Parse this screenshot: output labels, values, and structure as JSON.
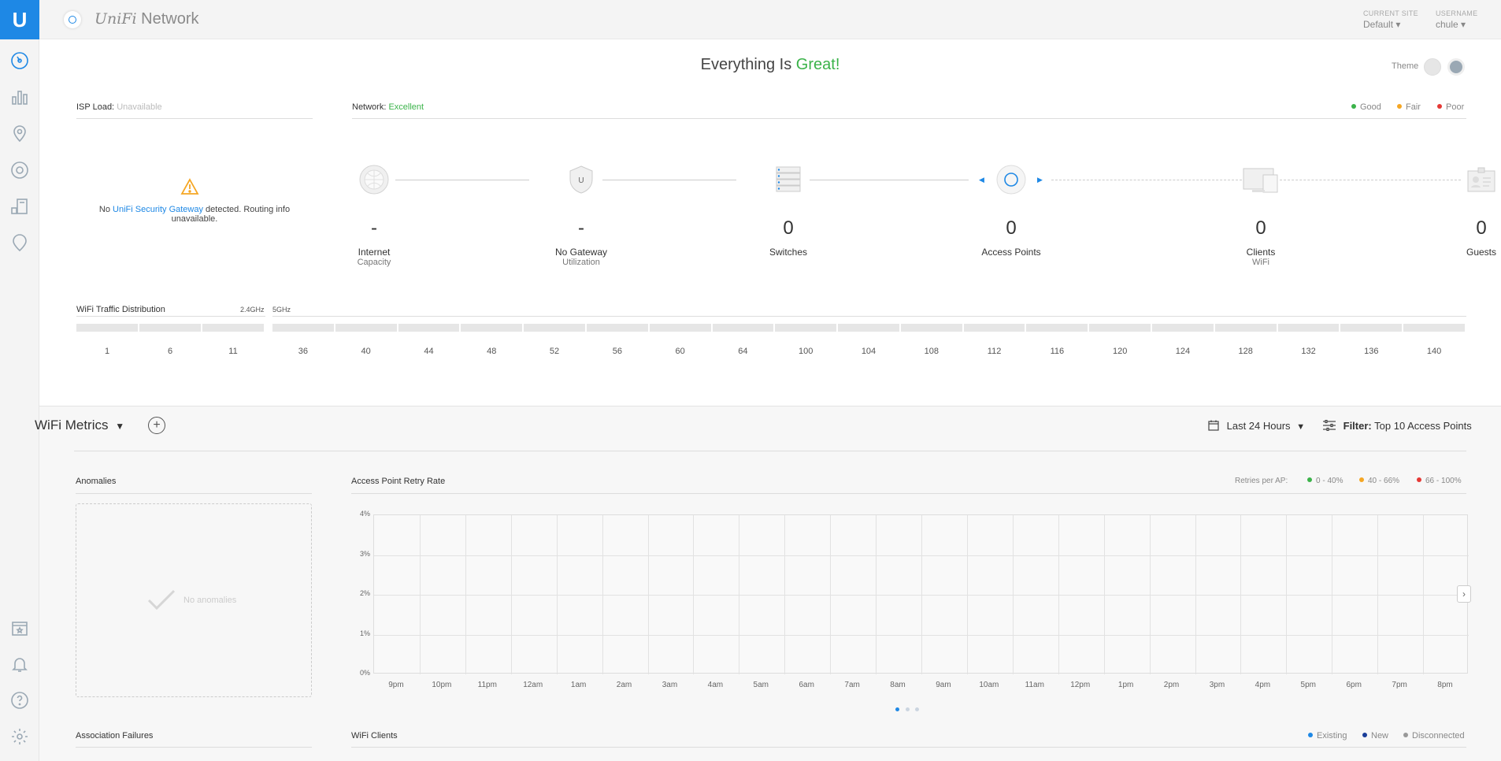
{
  "app": {
    "logo_letter": "U",
    "brand_italic": "UniFi",
    "brand_rest": " Network"
  },
  "header": {
    "site_label": "CURRENT SITE",
    "site_value": "Default ▾",
    "user_label": "USERNAME",
    "user_value": "chule ▾"
  },
  "status": {
    "prefix": "Everything Is ",
    "highlight": "Great!"
  },
  "theme_label": "Theme",
  "isp": {
    "label": "ISP Load:",
    "value": "Unavailable"
  },
  "network": {
    "label": "Network:",
    "value": "Excellent"
  },
  "health_legend": [
    {
      "label": "Good",
      "color": "#3bb34a"
    },
    {
      "label": "Fair",
      "color": "#f5a623"
    },
    {
      "label": "Poor",
      "color": "#e53935"
    }
  ],
  "gateway_warning": {
    "pre": "No ",
    "link": "UniFi Security Gateway",
    "post": " detected. Routing info unavailable."
  },
  "topology": [
    {
      "icon": "globe-icon",
      "value": "-",
      "name": "Internet",
      "sub": "Capacity"
    },
    {
      "icon": "gateway-shield-icon",
      "value": "-",
      "name": "No Gateway",
      "sub": "Utilization"
    },
    {
      "icon": "switch-icon",
      "value": "0",
      "name": "Switches",
      "sub": ""
    },
    {
      "icon": "access-point-icon",
      "value": "0",
      "name": "Access Points",
      "sub": ""
    },
    {
      "icon": "devices-icon",
      "value": "0",
      "name": "Clients",
      "sub": "WiFi"
    },
    {
      "icon": "guest-badge-icon",
      "value": "0",
      "name": "Guests",
      "sub": ""
    }
  ],
  "wifi_dist": {
    "title": "WiFi Traffic Distribution",
    "band24": "2.4GHz",
    "band5": "5GHz",
    "channels24": [
      "1",
      "6",
      "11"
    ],
    "channels5": [
      "36",
      "40",
      "44",
      "48",
      "52",
      "56",
      "60",
      "64",
      "100",
      "104",
      "108",
      "112",
      "116",
      "120",
      "124",
      "128",
      "132",
      "136",
      "140"
    ]
  },
  "metrics": {
    "title": "WiFi Metrics",
    "range": "Last 24 Hours",
    "filter_key": "Filter:",
    "filter_value": "Top 10 Access Points"
  },
  "anomalies": {
    "title": "Anomalies",
    "empty": "No anomalies"
  },
  "retry": {
    "title": "Access Point Retry Rate",
    "legend_title": "Retries per AP:",
    "legend": [
      {
        "label": "0 - 40%",
        "color": "#3bb34a"
      },
      {
        "label": "40 - 66%",
        "color": "#f5a623"
      },
      {
        "label": "66 - 100%",
        "color": "#e53935"
      }
    ]
  },
  "chart_data": {
    "type": "line",
    "title": "Access Point Retry Rate",
    "xlabel": "",
    "ylabel": "",
    "y_ticks": [
      "4%",
      "3%",
      "2%",
      "1%",
      "0%"
    ],
    "x": [
      "9pm",
      "10pm",
      "11pm",
      "12am",
      "1am",
      "2am",
      "3am",
      "4am",
      "5am",
      "6am",
      "7am",
      "8am",
      "9am",
      "10am",
      "11am",
      "12pm",
      "1pm",
      "2pm",
      "3pm",
      "4pm",
      "5pm",
      "6pm",
      "7pm",
      "8pm"
    ],
    "ylim": [
      0,
      4
    ],
    "series": [],
    "grid": true
  },
  "assoc": {
    "title": "Association Failures"
  },
  "clients": {
    "title": "WiFi Clients",
    "legend": [
      {
        "label": "Existing",
        "color": "#1e88e5"
      },
      {
        "label": "New",
        "color": "#1a3d99"
      },
      {
        "label": "Disconnected",
        "color": "#999"
      }
    ]
  }
}
